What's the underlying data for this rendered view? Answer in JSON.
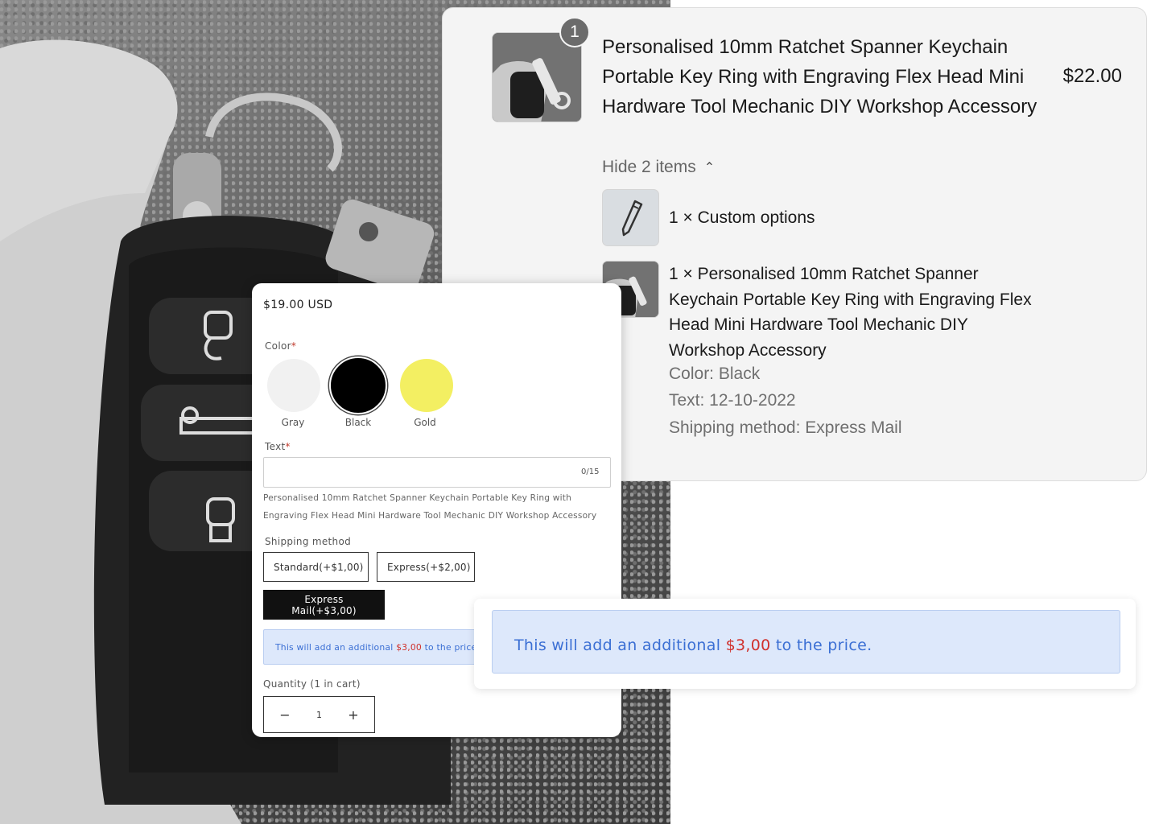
{
  "cart": {
    "qty_badge": "1",
    "title": "Personalised 10mm Ratchet Spanner Keychain Portable Key Ring with Engraving Flex Head Mini Hardware Tool Mechanic DIY Workshop Accessory",
    "price": "$22.00",
    "toggle_label": "Hide 2 items",
    "items": [
      {
        "text": "1 × Custom options",
        "icon": "pencil-icon"
      },
      {
        "text": "1 × Personalised 10mm Ratchet Spanner Keychain Portable Key Ring with Engraving Flex Head Mini Hardware Tool Mechanic DIY Workshop Accessory"
      }
    ],
    "properties": [
      "Color: Black",
      "Text: 12-10-2022",
      "Shipping method: Express Mail"
    ]
  },
  "form": {
    "price": "$19.00 USD",
    "color_label": "Color",
    "required_mark": "*",
    "swatches": [
      {
        "label": "Gray",
        "color": "#f1f1f1"
      },
      {
        "label": "Black",
        "color": "#000000",
        "selected": true
      },
      {
        "label": "Gold",
        "color": "#f3ef62"
      }
    ],
    "text_label": "Text",
    "text_value": "",
    "char_count": "0/15",
    "help_text": "Personalised 10mm Ratchet Spanner Keychain Portable Key Ring with Engraving Flex Head Mini Hardware Tool Mechanic DIY Workshop Accessory",
    "shipping_label": "Shipping method",
    "shipping_options": [
      {
        "label": "Standard(+$1,00)"
      },
      {
        "label": "Express(+$2,00)"
      },
      {
        "label": "Express Mail(+$3,00)",
        "selected": true
      }
    ],
    "notice": {
      "before": "This will add an additional ",
      "amount": "$3,00",
      "after": " to the price."
    },
    "quantity_label": "Quantity (1 in cart)",
    "quantity_value": "1",
    "minus": "−",
    "plus": "+"
  },
  "notice_zoom": {
    "before": "This will add an additional ",
    "amount": "$3,00",
    "after": " to the price."
  },
  "colors": {
    "accent_blue": "#3b6fd4",
    "notice_bg": "#dde8fb",
    "price_red": "#d0302c",
    "selected_btn": "#111111"
  }
}
